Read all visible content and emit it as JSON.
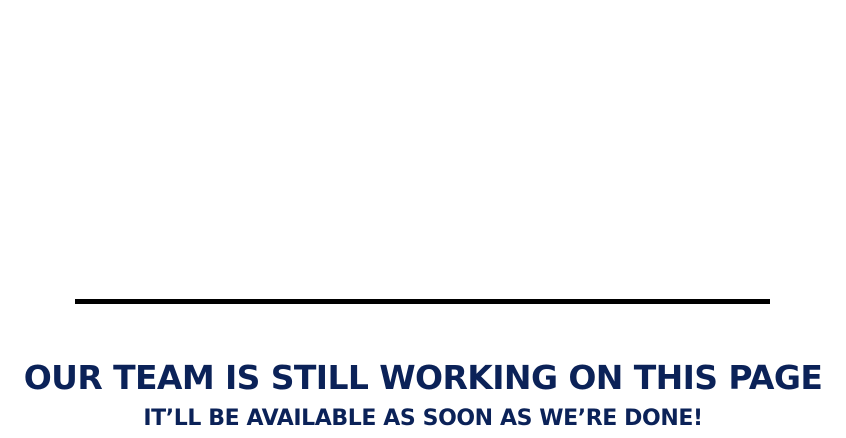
{
  "message": {
    "headline": "OUR TEAM IS STILL WORKING ON THIS PAGE",
    "subline": "IT’LL BE AVAILABLE AS SOON AS WE’RE DONE!"
  },
  "colors": {
    "text": "#0b2258",
    "divider": "#000000",
    "background": "#ffffff"
  }
}
